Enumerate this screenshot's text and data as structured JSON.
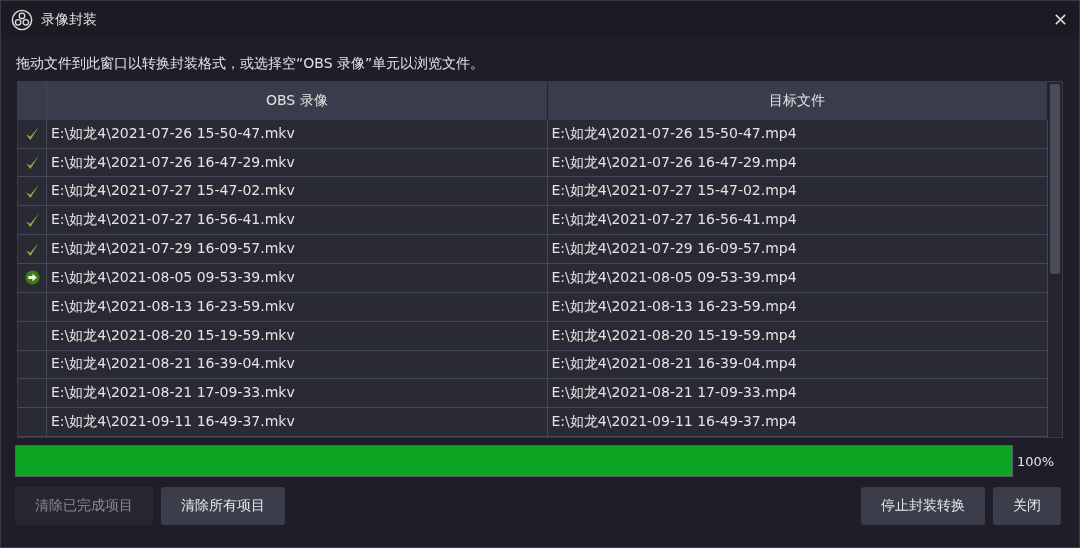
{
  "window": {
    "title": "录像封装"
  },
  "instruction": "拖动文件到此窗口以转换封装格式，或选择空“OBS 录像”单元以浏览文件。",
  "table": {
    "columns": [
      "OBS 录像",
      "目标文件"
    ],
    "rows": [
      {
        "kind": "done",
        "source": "E:\\如龙4\\2021-07-26 15-50-47.mkv",
        "target": "E:\\如龙4\\2021-07-26 15-50-47.mp4"
      },
      {
        "kind": "done",
        "source": "E:\\如龙4\\2021-07-26 16-47-29.mkv",
        "target": "E:\\如龙4\\2021-07-26 16-47-29.mp4"
      },
      {
        "kind": "done",
        "source": "E:\\如龙4\\2021-07-27 15-47-02.mkv",
        "target": "E:\\如龙4\\2021-07-27 15-47-02.mp4"
      },
      {
        "kind": "done",
        "source": "E:\\如龙4\\2021-07-27 16-56-41.mkv",
        "target": "E:\\如龙4\\2021-07-27 16-56-41.mp4"
      },
      {
        "kind": "done",
        "source": "E:\\如龙4\\2021-07-29 16-09-57.mkv",
        "target": "E:\\如龙4\\2021-07-29 16-09-57.mp4"
      },
      {
        "kind": "running",
        "source": "E:\\如龙4\\2021-08-05 09-53-39.mkv",
        "target": "E:\\如龙4\\2021-08-05 09-53-39.mp4"
      },
      {
        "kind": "pending",
        "source": "E:\\如龙4\\2021-08-13 16-23-59.mkv",
        "target": "E:\\如龙4\\2021-08-13 16-23-59.mp4"
      },
      {
        "kind": "pending",
        "source": "E:\\如龙4\\2021-08-20 15-19-59.mkv",
        "target": "E:\\如龙4\\2021-08-20 15-19-59.mp4"
      },
      {
        "kind": "pending",
        "source": "E:\\如龙4\\2021-08-21 16-39-04.mkv",
        "target": "E:\\如龙4\\2021-08-21 16-39-04.mp4"
      },
      {
        "kind": "pending",
        "source": "E:\\如龙4\\2021-08-21 17-09-33.mkv",
        "target": "E:\\如龙4\\2021-08-21 17-09-33.mp4"
      },
      {
        "kind": "pending",
        "source": "E:\\如龙4\\2021-09-11 16-49-37.mkv",
        "target": "E:\\如龙4\\2021-09-11 16-49-37.mp4"
      }
    ]
  },
  "progress": {
    "level": 1.0,
    "reading": "100%"
  },
  "buttons": [
    {
      "label": "清除已完成项目",
      "disabled": true
    },
    {
      "label": "清除所有项目",
      "disabled": false
    },
    {
      "label": "停止封装转换",
      "disabled": false
    },
    {
      "label": "关闭",
      "disabled": false
    }
  ]
}
